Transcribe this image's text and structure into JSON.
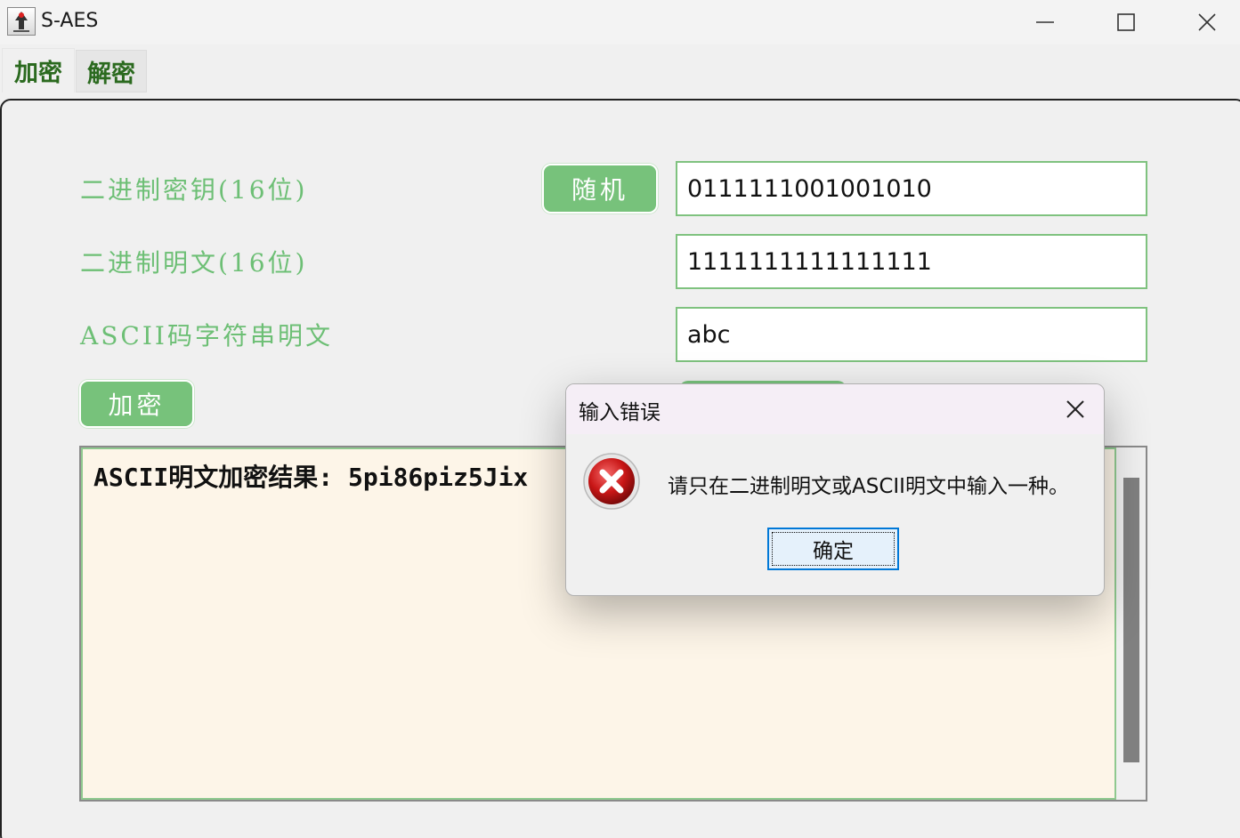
{
  "window": {
    "title": "S-AES",
    "icon": "java-app-icon",
    "controls": [
      "minimize-icon",
      "maximize-icon",
      "close-icon"
    ]
  },
  "tabs": [
    {
      "label": "加密",
      "active": true
    },
    {
      "label": "解密",
      "active": false
    }
  ],
  "encrypt": {
    "key_label": "二进制密钥(16位)",
    "random_button": "随机",
    "key_value": "0111111001001010",
    "plaintext_label": "二进制明文(16位)",
    "plaintext_value": "1111111111111111",
    "ascii_label": "ASCII码字符串明文",
    "ascii_value": "abc",
    "encrypt_button": "加密",
    "output": "ASCII明文加密结果: 5pi86piz5Jix"
  },
  "dialog": {
    "title": "输入错误",
    "message": "请只在二进制明文或ASCII明文中输入一种。",
    "ok_button": "确定",
    "icon": "error-icon"
  },
  "colors": {
    "label_green": "#6dbf75",
    "button_green": "#77c27b",
    "field_border": "#7fc27f",
    "output_bg": "#fdf5e8",
    "tab_text": "#2b6a1f"
  }
}
